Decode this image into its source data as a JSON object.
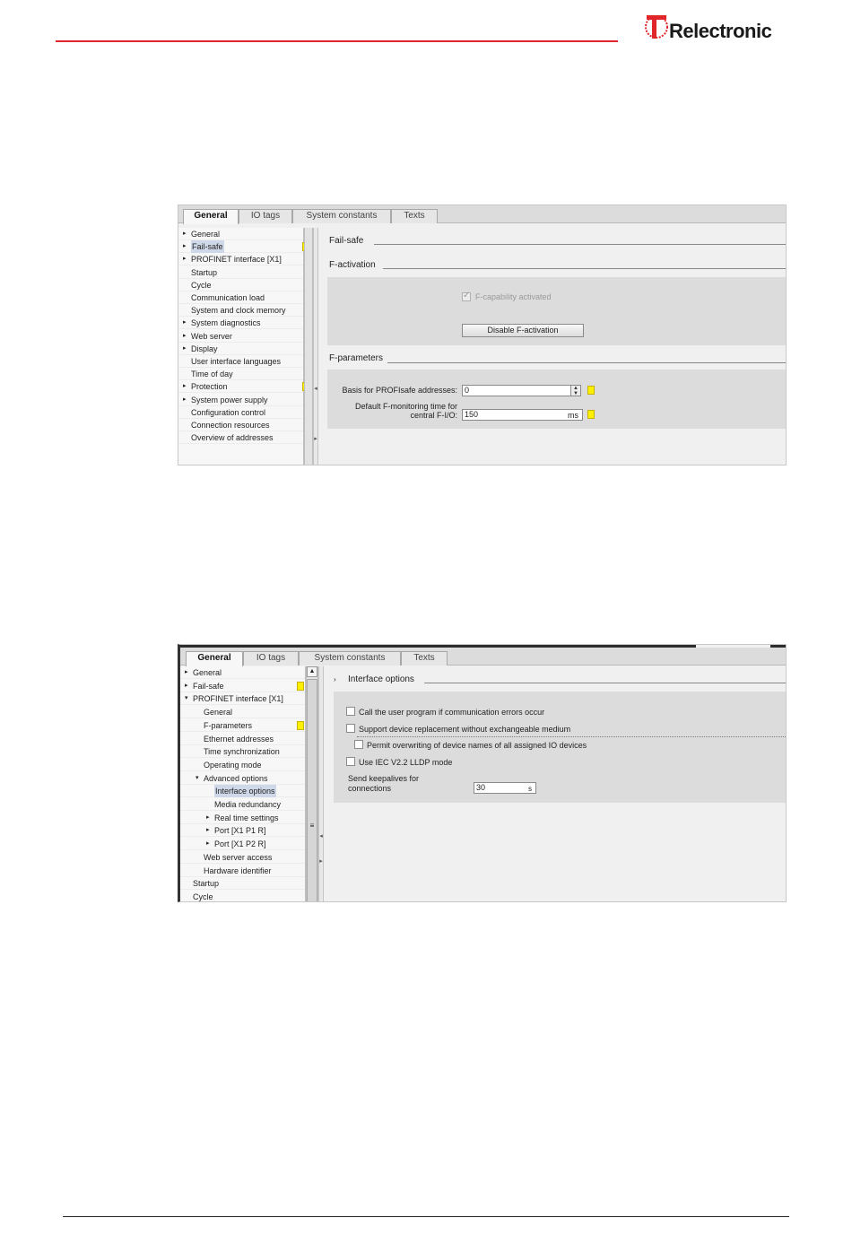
{
  "brand": {
    "logo_text": "Relectronic",
    "accent": "#e0252b",
    "flag_color": "#fff000"
  },
  "shot1": {
    "tabs": [
      "General",
      "IO tags",
      "System constants",
      "Texts"
    ],
    "nav": [
      {
        "label": "General",
        "arrow": "▸"
      },
      {
        "label": "Fail-safe",
        "arrow": "▸"
      },
      {
        "label": "PROFINET interface [X1]",
        "arrow": "▸"
      },
      {
        "label": "Startup",
        "arrow": ""
      },
      {
        "label": "Cycle",
        "arrow": ""
      },
      {
        "label": "Communication load",
        "arrow": ""
      },
      {
        "label": "System and clock memory",
        "arrow": ""
      },
      {
        "label": "System diagnostics",
        "arrow": "▸"
      },
      {
        "label": "Web server",
        "arrow": "▸"
      },
      {
        "label": "Display",
        "arrow": "▸"
      },
      {
        "label": "User interface languages",
        "arrow": ""
      },
      {
        "label": "Time of day",
        "arrow": ""
      },
      {
        "label": "Protection",
        "arrow": "▸"
      },
      {
        "label": "System power supply",
        "arrow": "▸"
      },
      {
        "label": "Configuration control",
        "arrow": ""
      },
      {
        "label": "Connection resources",
        "arrow": ""
      },
      {
        "label": "Overview of addresses",
        "arrow": ""
      }
    ],
    "failsafe_title": "Fail-safe",
    "factivation_title": "F-activation",
    "fcapability_label": "F-capability activated",
    "disable_button": "Disable F-activation",
    "fparams_title": "F-parameters",
    "basis_label": "Basis for PROFIsafe addresses:",
    "basis_value": "0",
    "monitor_label_1": "Default F-monitoring time for",
    "monitor_label_2": "central F-I/O:",
    "monitor_value": "150",
    "monitor_unit": "ms"
  },
  "shot2": {
    "tabs": [
      "General",
      "IO tags",
      "System constants",
      "Texts"
    ],
    "nav": [
      {
        "label": "General",
        "arrow": "▸"
      },
      {
        "label": "Fail-safe",
        "arrow": "▸"
      },
      {
        "label": "PROFINET interface [X1]",
        "arrow": "▾"
      },
      {
        "label": "General",
        "arrow": ""
      },
      {
        "label": "F-parameters",
        "arrow": ""
      },
      {
        "label": "Ethernet addresses",
        "arrow": ""
      },
      {
        "label": "Time synchronization",
        "arrow": ""
      },
      {
        "label": "Operating mode",
        "arrow": ""
      },
      {
        "label": "Advanced options",
        "arrow": "▾"
      },
      {
        "label": "Interface options",
        "arrow": ""
      },
      {
        "label": "Media redundancy",
        "arrow": ""
      },
      {
        "label": "Real time settings",
        "arrow": "▸"
      },
      {
        "label": "Port [X1 P1 R]",
        "arrow": "▸"
      },
      {
        "label": "Port [X1 P2 R]",
        "arrow": "▸"
      },
      {
        "label": "Web server access",
        "arrow": ""
      },
      {
        "label": "Hardware identifier",
        "arrow": ""
      },
      {
        "label": "Startup",
        "arrow": ""
      },
      {
        "label": "Cycle",
        "arrow": ""
      }
    ],
    "section_title": "Interface options",
    "opt1": "Call the user program if communication errors occur",
    "opt2": "Support device replacement without exchangeable medium",
    "opt3": "Permit overwriting of device names of all assigned IO devices",
    "opt4": "Use IEC V2.2 LLDP mode",
    "keepalive_label_1": "Send keepalives for",
    "keepalive_label_2": "connections",
    "keepalive_value": "30",
    "keepalive_unit": "s"
  }
}
